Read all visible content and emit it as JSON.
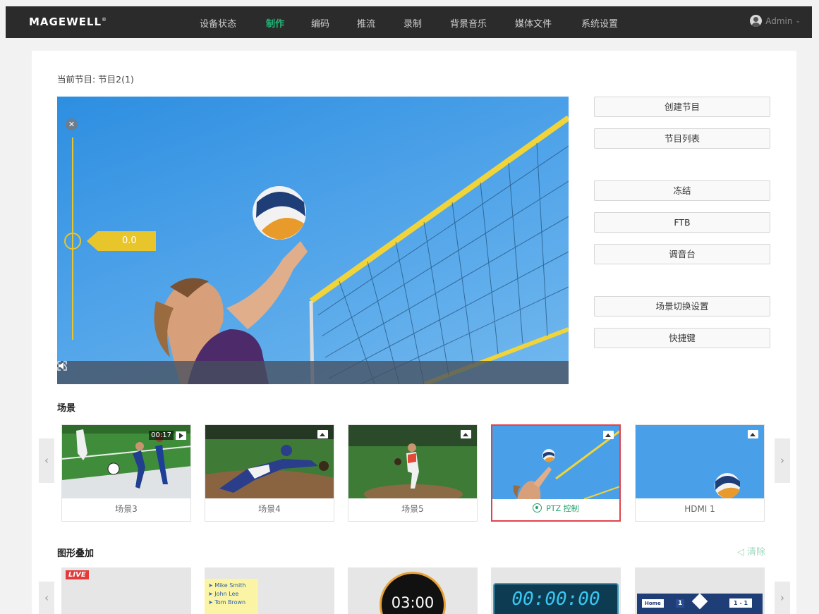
{
  "brand": {
    "logo": "MAGEWELL",
    "trademark": "®"
  },
  "nav": {
    "items": [
      "设备状态",
      "制作",
      "编码",
      "推流",
      "录制",
      "背景音乐",
      "媒体文件",
      "系统设置"
    ],
    "active_index": 1,
    "user": "Admin"
  },
  "main": {
    "current_program": "当前节目: 节目2(1)",
    "preview": {
      "audio_level": "0.0"
    },
    "buttons": [
      "创建节目",
      "节目列表",
      "冻结",
      "FTB",
      "调音台",
      "场景切换设置",
      "快捷键"
    ]
  },
  "scenes": {
    "title": "场景",
    "items": [
      {
        "label": "场景3",
        "badge": "video",
        "time": "00:17"
      },
      {
        "label": "场景4",
        "badge": "image"
      },
      {
        "label": "场景5",
        "badge": "image"
      },
      {
        "label": "PTZ 控制",
        "badge": "image",
        "selected": true
      },
      {
        "label": "HDMI 1",
        "badge": "image"
      }
    ]
  },
  "overlays": {
    "title": "图形叠加",
    "clear_label": "清除",
    "live_text": "LIVE",
    "names": [
      "Mike Smith",
      "John Lee",
      "Tom Brown"
    ],
    "countdown": "03:00",
    "clock": "00:00:00",
    "score": {
      "home": "Home",
      "home_score": "1",
      "result": "1 - 1"
    }
  },
  "colors": {
    "accent": "#23b87a",
    "selected": "#e0434d",
    "audio": "#e8c52a"
  }
}
